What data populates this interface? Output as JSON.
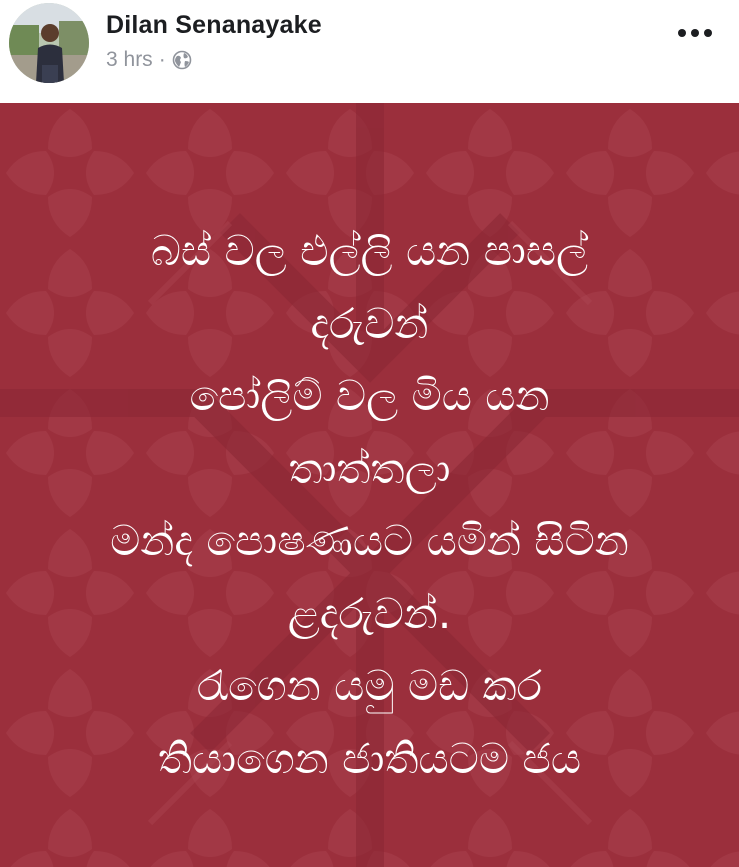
{
  "post": {
    "author_name": "Dilan Senanayake",
    "timestamp": "3 hrs",
    "separator": "·",
    "privacy_icon": "globe-icon",
    "more_icon": "more-options-icon",
    "background_color": "#9b2f3c",
    "text_lines": [
      "බස් වල එල්ලි යන පාසල්",
      "දරුවන්",
      "පෝලිම් වල මිය යන",
      "තාත්තලා",
      "මන්ද පොෂණයට යමින් සිටින",
      "ළදරුවන්.",
      "රැගෙන යමු මඩ කර",
      "තියාගෙන ජාතියටම ජය"
    ]
  }
}
